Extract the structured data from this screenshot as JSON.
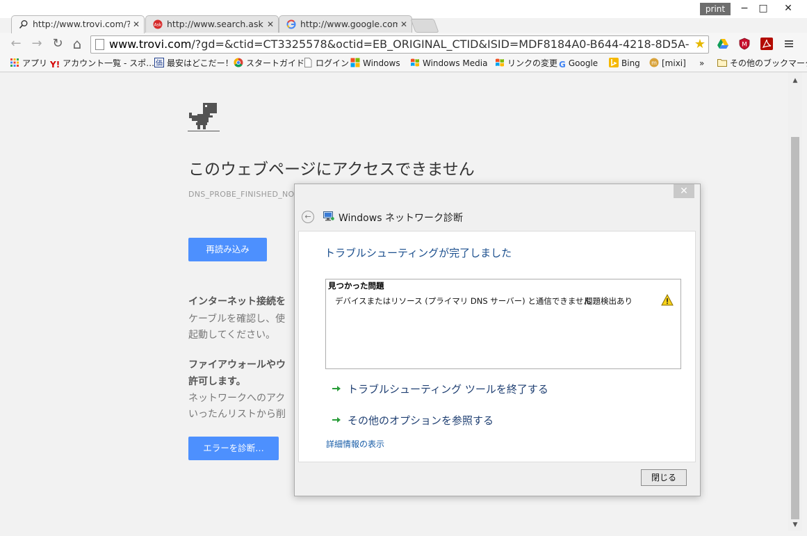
{
  "window": {
    "print_badge": "print",
    "minimize": "−",
    "maximize": "□",
    "close": "✕"
  },
  "tabs": [
    {
      "label": "http://www.trovi.com/?",
      "icon": "search-icon",
      "active": true
    },
    {
      "label": "http://www.search.ask.",
      "icon": "ask-icon",
      "active": false
    },
    {
      "label": "http://www.google.com",
      "icon": "google-icon",
      "active": false
    }
  ],
  "tab_close": "✕",
  "nav": {
    "back": "←",
    "forward": "→",
    "reload": "↻",
    "home": "⌂"
  },
  "omnibox": {
    "host": "www.trovi.com",
    "path": "/?gd=&ctid=CT3325578&octid=EB_ORIGINAL_CTID&ISID=MDF8184A0-B644-4218-8D5A-"
  },
  "bookmarks": [
    {
      "label": "アプリ",
      "icon": "apps-grid-icon"
    },
    {
      "label": "アカウント一覧 - スポ…",
      "icon": "yahoo-icon"
    },
    {
      "label": "最安はどこだー！",
      "icon": "price-icon"
    },
    {
      "label": "スタートガイド",
      "icon": "chrome-icon"
    },
    {
      "label": "ログイン",
      "icon": "page-icon"
    },
    {
      "label": "Windows",
      "icon": "windows-icon"
    },
    {
      "label": "Windows Media",
      "icon": "windows-media-icon"
    },
    {
      "label": "リンクの変更",
      "icon": "windows-links-icon"
    },
    {
      "label": "Google",
      "icon": "google-icon"
    },
    {
      "label": "Bing",
      "icon": "bing-icon"
    },
    {
      "label": "[mixi]",
      "icon": "mixi-icon"
    },
    {
      "label": "»",
      "icon": ""
    },
    {
      "label": "その他のブックマーク",
      "icon": "folder-icon"
    }
  ],
  "error_page": {
    "title": "このウェブページにアクセスできません",
    "code": "DNS_PROBE_FINISHED_NO",
    "reload_button": "再読み込み",
    "section1_head": "インターネット接続を",
    "section1_body_1": "ケーブルを確認し、使",
    "section1_body_2": "起動してください。",
    "section2_head_1": "ファイアウォールやウ",
    "section2_head_2": "許可します。",
    "section2_body_1": "ネットワークへのアク",
    "section2_body_2": "いったんリストから削",
    "diagnose_button": "エラーを診断…"
  },
  "dialog": {
    "close_x": "✕",
    "back": "←",
    "app_title": "Windows ネットワーク診断",
    "heading": "トラブルシューティングが完了しました",
    "issues_header": "見つかった問題",
    "issue_text": "デバイスまたはリソース (プライマリ DNS サーバー) と通信できません",
    "issue_status": "問題検出あり",
    "option_close_tool": "トラブルシューティング ツールを終了する",
    "option_more": "その他のオプションを参照する",
    "details_link": "詳細情報の表示",
    "close_button": "閉じる"
  },
  "scrollbar": {
    "up": "▲",
    "down": "▼"
  }
}
